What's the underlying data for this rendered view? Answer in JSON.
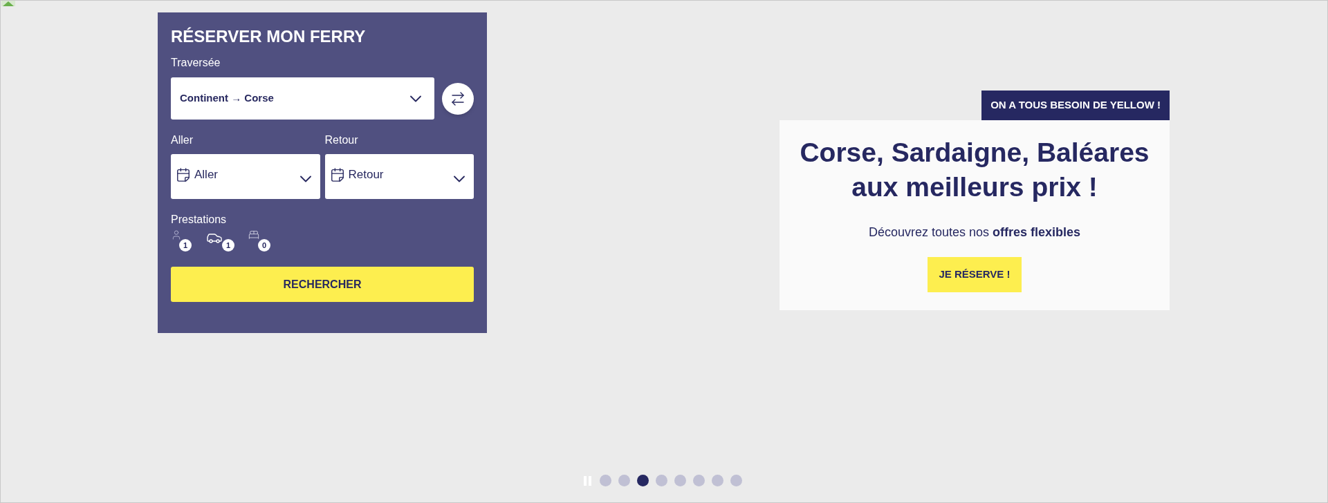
{
  "booking": {
    "title": "RÉSERVER MON FERRY",
    "route_label": "Traversée",
    "route_value": "Continent → Corse",
    "dates": [
      {
        "label": "Aller",
        "placeholder": "Aller"
      },
      {
        "label": "Retour",
        "placeholder": "Retour"
      }
    ],
    "services_label": "Prestations",
    "services": [
      {
        "kind": "passenger",
        "count": "1"
      },
      {
        "kind": "vehicle",
        "count": "1"
      },
      {
        "kind": "cabin",
        "count": "0"
      }
    ],
    "search_button": "RECHERCHER"
  },
  "promo": {
    "tag": "ON A TOUS BESOIN DE YELLOW !",
    "heading": [
      "Corse, Sardaigne, Baléares",
      "aux meilleurs prix !"
    ],
    "subtitle": "Découvrez toutes nos **offres flexibles**",
    "button": "JE RÉSERVE !"
  },
  "carousel": {
    "dots": [
      {
        "selected": false
      },
      {
        "selected": false
      },
      {
        "selected": true
      },
      {
        "selected": false
      },
      {
        "selected": false
      },
      {
        "selected": false
      },
      {
        "selected": false
      },
      {
        "selected": false
      }
    ]
  }
}
